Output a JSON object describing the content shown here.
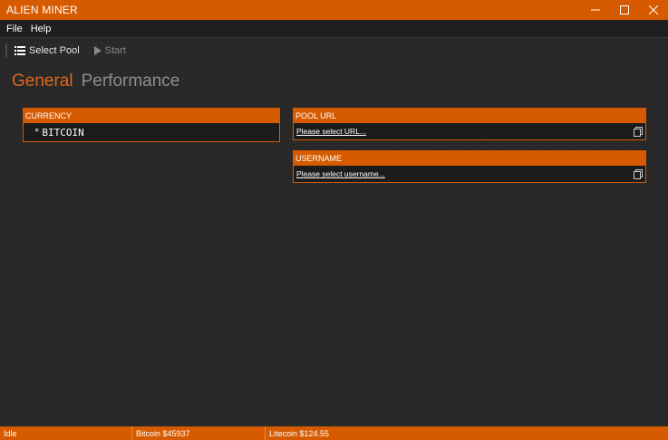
{
  "window": {
    "title": "ALIEN MINER",
    "controls": {
      "minimize": "—",
      "maximize": "☐",
      "close": "✕"
    }
  },
  "menu": {
    "items": [
      "File",
      "Help"
    ]
  },
  "toolbar": {
    "select_pool_label": "Select Pool",
    "start_label": "Start"
  },
  "tabs": {
    "general": "General",
    "performance": "Performance",
    "active": "General"
  },
  "currency": {
    "header": "CURRENCY",
    "selected": "BITCOIN",
    "bullet": "*"
  },
  "pool_url": {
    "header": "POOL URL",
    "value": "Please select URL..."
  },
  "username": {
    "header": "USERNAME",
    "value": "Please select username..."
  },
  "status": {
    "state": "Idle",
    "bitcoin": "Bitcoin $45937",
    "litecoin": "Litecoin $124.55"
  },
  "colors": {
    "accent": "#d65b00",
    "background": "#262626",
    "active_tab": "#e0661a"
  }
}
